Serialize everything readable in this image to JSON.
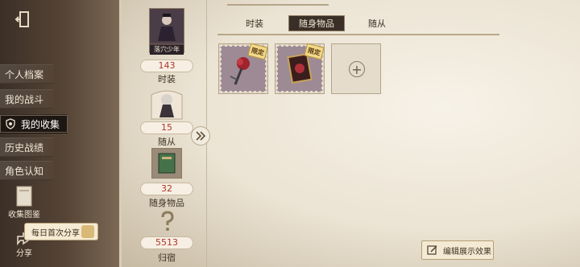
{
  "nav": {
    "items": [
      {
        "label": "个人档案",
        "active": false
      },
      {
        "label": "我的战斗",
        "active": false
      },
      {
        "label": "我的收集",
        "active": true
      },
      {
        "label": "历史战绩",
        "active": false
      },
      {
        "label": "角色认知",
        "active": false
      }
    ]
  },
  "bottom": {
    "collection_album": "收集图鉴",
    "share": "分享",
    "share_tip": "每日首次分享"
  },
  "categories": [
    {
      "count": "143",
      "label": "时装",
      "thumb_caption": "落穴少年"
    },
    {
      "count": "15",
      "label": "随从"
    },
    {
      "count": "32",
      "label": "随身物品"
    },
    {
      "count": "5513",
      "label": "归宿"
    }
  ],
  "tabs": [
    {
      "label": "时装",
      "active": false
    },
    {
      "label": "随身物品",
      "active": true
    },
    {
      "label": "随从",
      "active": false
    }
  ],
  "items": [
    {
      "badge": "限定",
      "type": "rose"
    },
    {
      "badge": "限定",
      "type": "card"
    },
    {
      "type": "add"
    }
  ],
  "edit_button": "编辑展示效果",
  "colors": {
    "count_red": "#b0352a",
    "active_tab": "#3a2f27",
    "limited_badge": "#f2d98a"
  }
}
